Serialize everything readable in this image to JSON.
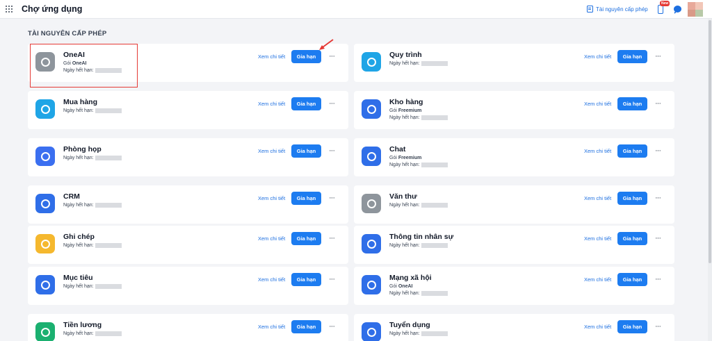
{
  "header": {
    "title": "Chợ ứng dụng",
    "license_link": "Tài nguyên cấp phép",
    "new_badge": "New"
  },
  "section": {
    "title": "TÀI NGUYÊN CẤP PHÉP"
  },
  "labels": {
    "view_details": "Xem chi tiết",
    "renew": "Gia hạn",
    "more": "···",
    "package_prefix": "Gói",
    "expiry_label": "Ngày hết hạn:"
  },
  "apps": [
    {
      "name": "OneAI",
      "package": "OneAI",
      "icon": "oneai-icon",
      "color": "#8e959c"
    },
    {
      "name": "Quy trình",
      "package": "",
      "icon": "process-icon",
      "color": "#1fa5e6"
    },
    {
      "name": "Mua hàng",
      "package": "",
      "icon": "purchase-icon",
      "color": "#1fa5e6"
    },
    {
      "name": "Kho hàng",
      "package": "Freemium",
      "icon": "warehouse-icon",
      "color": "#2f6ee8"
    },
    {
      "name": "Phòng họp",
      "package": "",
      "icon": "meeting-room-icon",
      "color": "#3b6ff0"
    },
    {
      "name": "Chat",
      "package": "Freemium",
      "icon": "chat-app-icon",
      "color": "#2f6ee8"
    },
    {
      "name": "CRM",
      "package": "",
      "icon": "crm-icon",
      "color": "#2f6ee8"
    },
    {
      "name": "Văn thư",
      "package": "",
      "icon": "clerical-icon",
      "color": "#8e959c"
    },
    {
      "name": "Ghi chép",
      "package": "",
      "icon": "notes-icon",
      "color": "#f5b82e"
    },
    {
      "name": "Thông tin nhân sự",
      "package": "",
      "icon": "hr-info-icon",
      "color": "#2f6ee8"
    },
    {
      "name": "Mục tiêu",
      "package": "",
      "icon": "goals-icon",
      "color": "#2f6ee8"
    },
    {
      "name": "Mạng xã hội",
      "package": "OneAI",
      "icon": "social-network-icon",
      "color": "#2f6ee8"
    },
    {
      "name": "Tiền lương",
      "package": "",
      "icon": "salary-icon",
      "color": "#1bb070"
    },
    {
      "name": "Tuyển dụng",
      "package": "",
      "icon": "recruitment-icon",
      "color": "#2f6ee8"
    }
  ]
}
